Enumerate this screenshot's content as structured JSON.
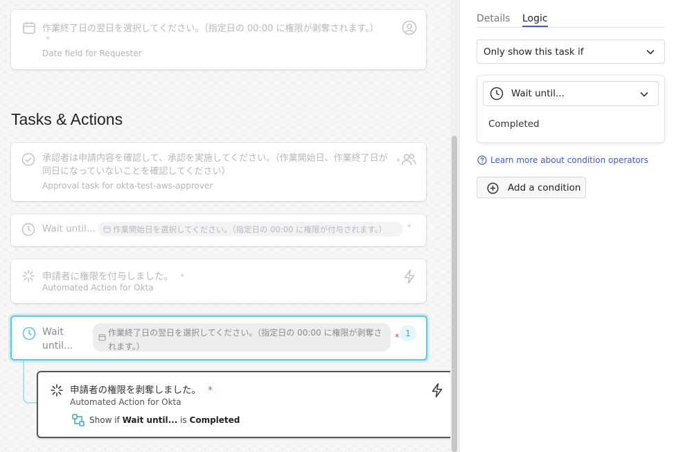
{
  "canvas": {
    "section_title": "Tasks & Actions",
    "date_card": {
      "title": "作業終了日の翌日を選択してください。（指定日の 00:00 に権限が剥奪されます。）",
      "required_mark": "*",
      "subtitle": "Date field for Requester"
    },
    "approval_card": {
      "title": "承認者は申請内容を確認して、承認を実施してください。（作業開始日、作業終了日が同日になっていないことを確認してください）",
      "required_mark": "*",
      "subtitle": "Approval task for okta-test-aws-approver"
    },
    "wait_card_1": {
      "label": "Wait until...",
      "chip_text": "作業開始日を選択してください。（指定日の 00:00 に権限が付与されます。）",
      "required_mark": "*"
    },
    "grant_action_card": {
      "title": "申請者に権限を付与しました。",
      "required_mark": "*",
      "subtitle": "Automated Action for Okta"
    },
    "wait_card_2": {
      "label": "Wait until...",
      "chip_text": "作業終了日の翌日を選択してください。（指定日の 00:00 に権限が剥奪されます。）",
      "required_mark": "*",
      "badge": "1"
    },
    "revoke_action_card": {
      "title": "申請者の権限を剥奪しました。",
      "required_mark": "*",
      "subtitle": "Automated Action for Okta",
      "condition_prefix": "Show if",
      "condition_subject": "Wait until...",
      "condition_operator": "is",
      "condition_value": "Completed"
    }
  },
  "panel": {
    "tabs": [
      "Details",
      "Logic"
    ],
    "active_tab": "Logic",
    "visibility_select": "Only show this task if",
    "condition_select": "Wait until...",
    "condition_option": "Completed",
    "help_link": "Learn more about condition operators",
    "add_condition_button": "Add a condition"
  },
  "colors": {
    "accent_cyan": "#5fc8d9",
    "link_blue": "#3b5bdb",
    "required_red": "#e5484d",
    "tab_underline": "#3b5bdb"
  }
}
